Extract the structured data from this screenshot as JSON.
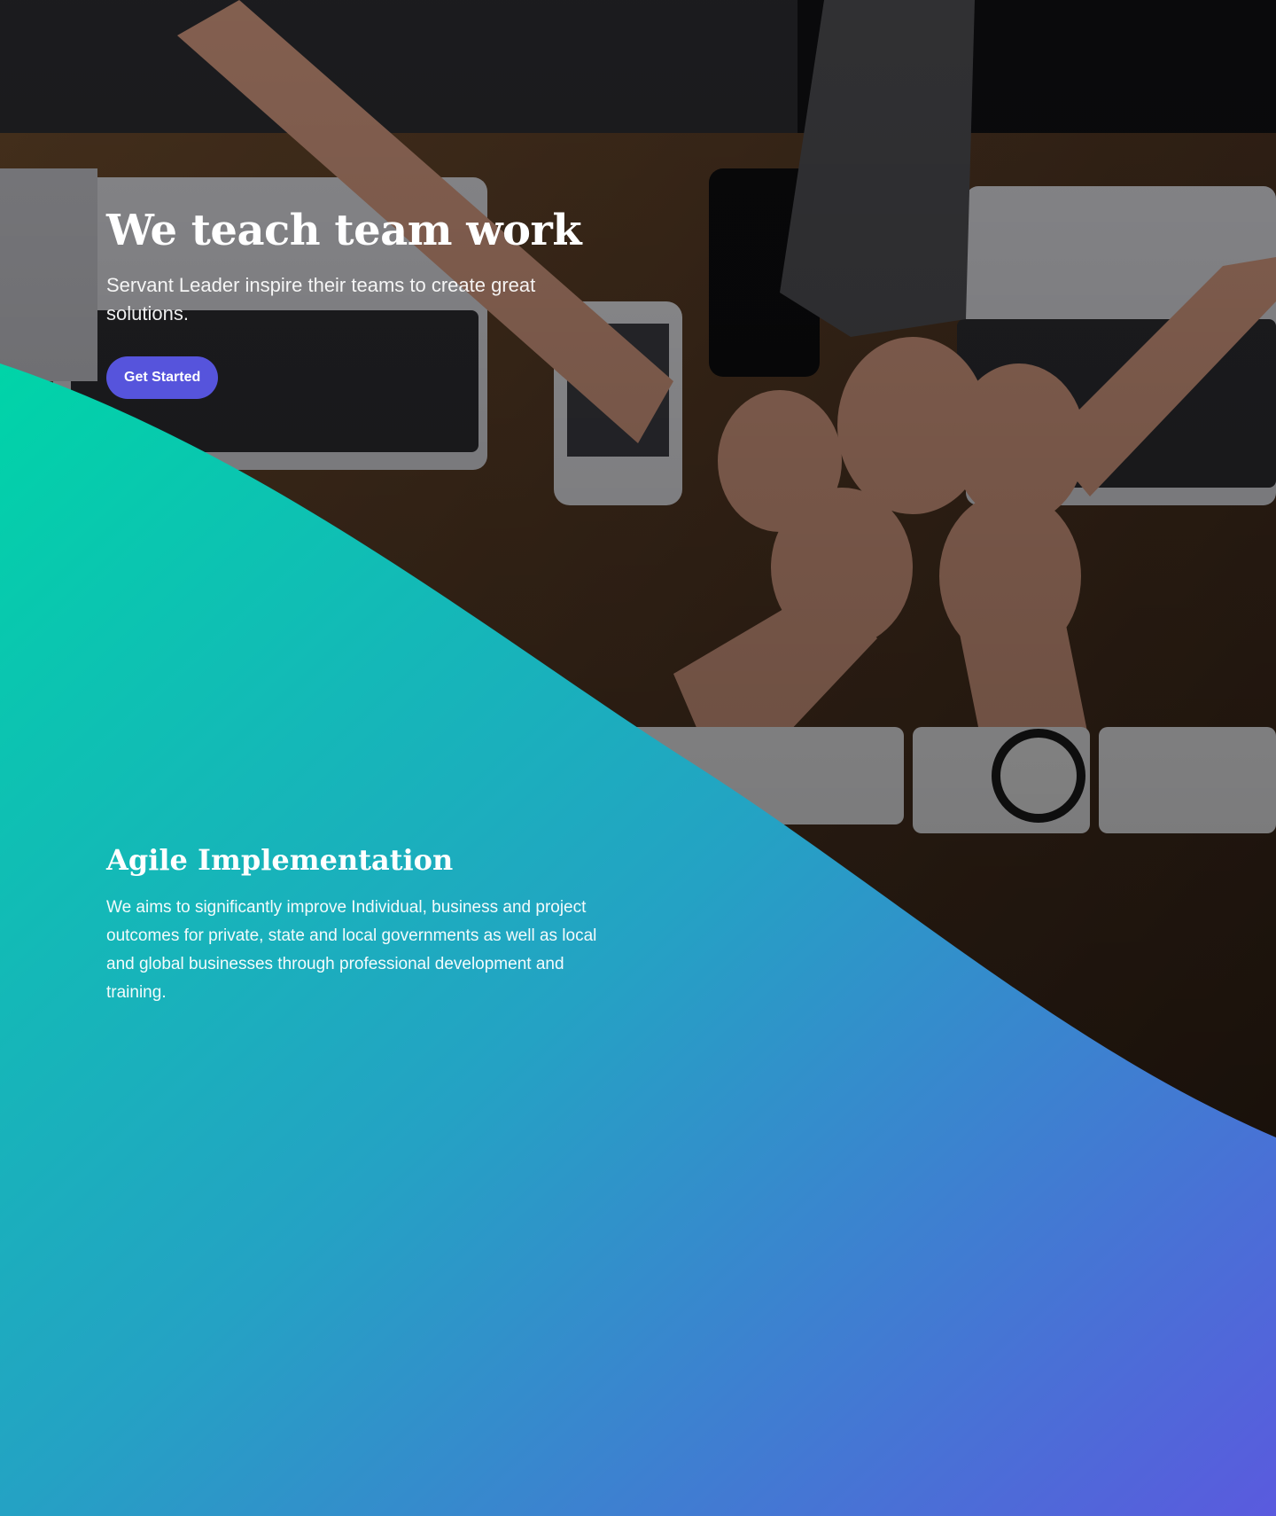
{
  "hero": {
    "title": "We teach team work",
    "subtitle": "Servant Leader inspire their teams to create great solutions.",
    "cta_label": "Get Started"
  },
  "feature": {
    "title": "Agile Implementation",
    "text": "We aims to significantly improve Individual, business and project outcomes for private, state and local governments as well as local and global businesses through professional development and training."
  },
  "colors": {
    "accent": "#5654dc",
    "gradient_start": "#00d4a8",
    "gradient_mid": "#24a2c4",
    "gradient_end": "#5a5ade"
  }
}
